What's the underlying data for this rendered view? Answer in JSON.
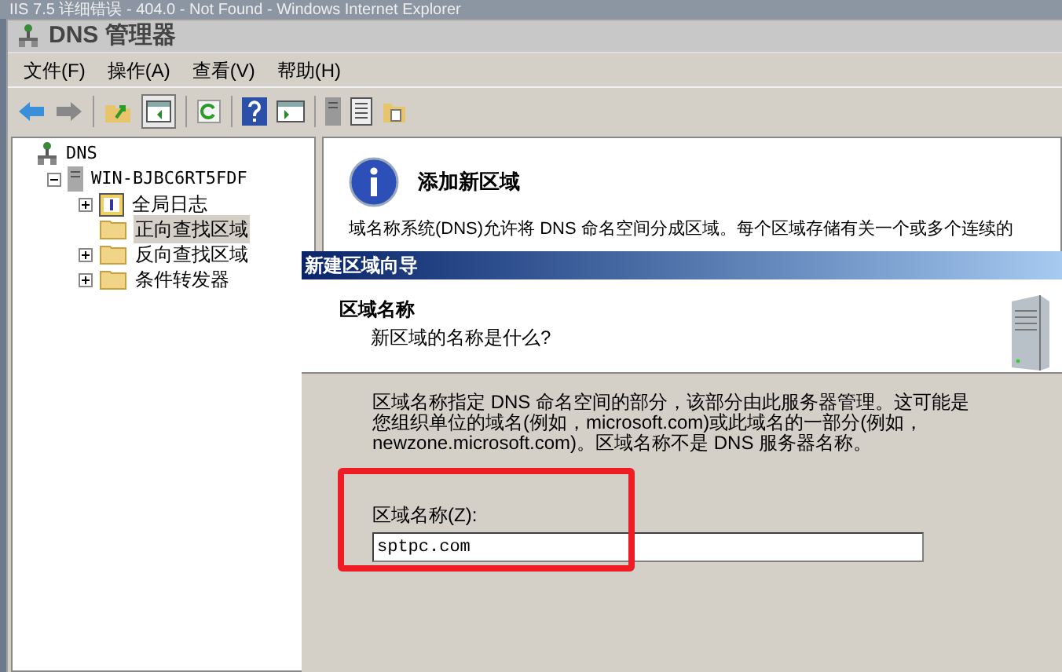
{
  "background_window": {
    "title": "IIS 7.5 详细错误 - 404.0 - Not Found - Windows Internet Explorer"
  },
  "window": {
    "title": "DNS 管理器"
  },
  "menu": [
    "文件(F)",
    "操作(A)",
    "查看(V)",
    "帮助(H)"
  ],
  "toolbar": {
    "console_tree_button": {
      "selected": true
    }
  },
  "tree": [
    {
      "label": "DNS",
      "kind": "dns",
      "selected": false,
      "children": [
        {
          "label": "WIN-BJBC6RT5FDF",
          "kind": "server",
          "selected": false,
          "expanded": true,
          "children": [
            {
              "label": "全局日志",
              "kind": "log",
              "selected": false,
              "expanded": false
            },
            {
              "label": "正向查找区域",
              "kind": "folder",
              "selected": true
            },
            {
              "label": "反向查找区域",
              "kind": "folder",
              "selected": false,
              "expanded": false
            },
            {
              "label": "条件转发器",
              "kind": "folder",
              "selected": false,
              "expanded": false
            }
          ]
        }
      ]
    }
  ],
  "details": {
    "title": "添加新区域",
    "text": "域名称系统(DNS)允许将 DNS 命名空间分成区域。每个区域存储有关一个或多个连续的"
  },
  "wizard": {
    "title": "新建区域向导",
    "heading": "区域名称",
    "subheading": "新区域的名称是什么?",
    "description": "区域名称指定 DNS 命名空间的部分，该部分由此服务器管理。这可能是您组织单位的域名(例如，microsoft.com)或此域名的一部分(例如，newzone.microsoft.com)。区域名称不是 DNS 服务器名称。",
    "field": {
      "label": "区域名称(Z):",
      "value": "sptpc.com",
      "highlighted": true
    }
  }
}
